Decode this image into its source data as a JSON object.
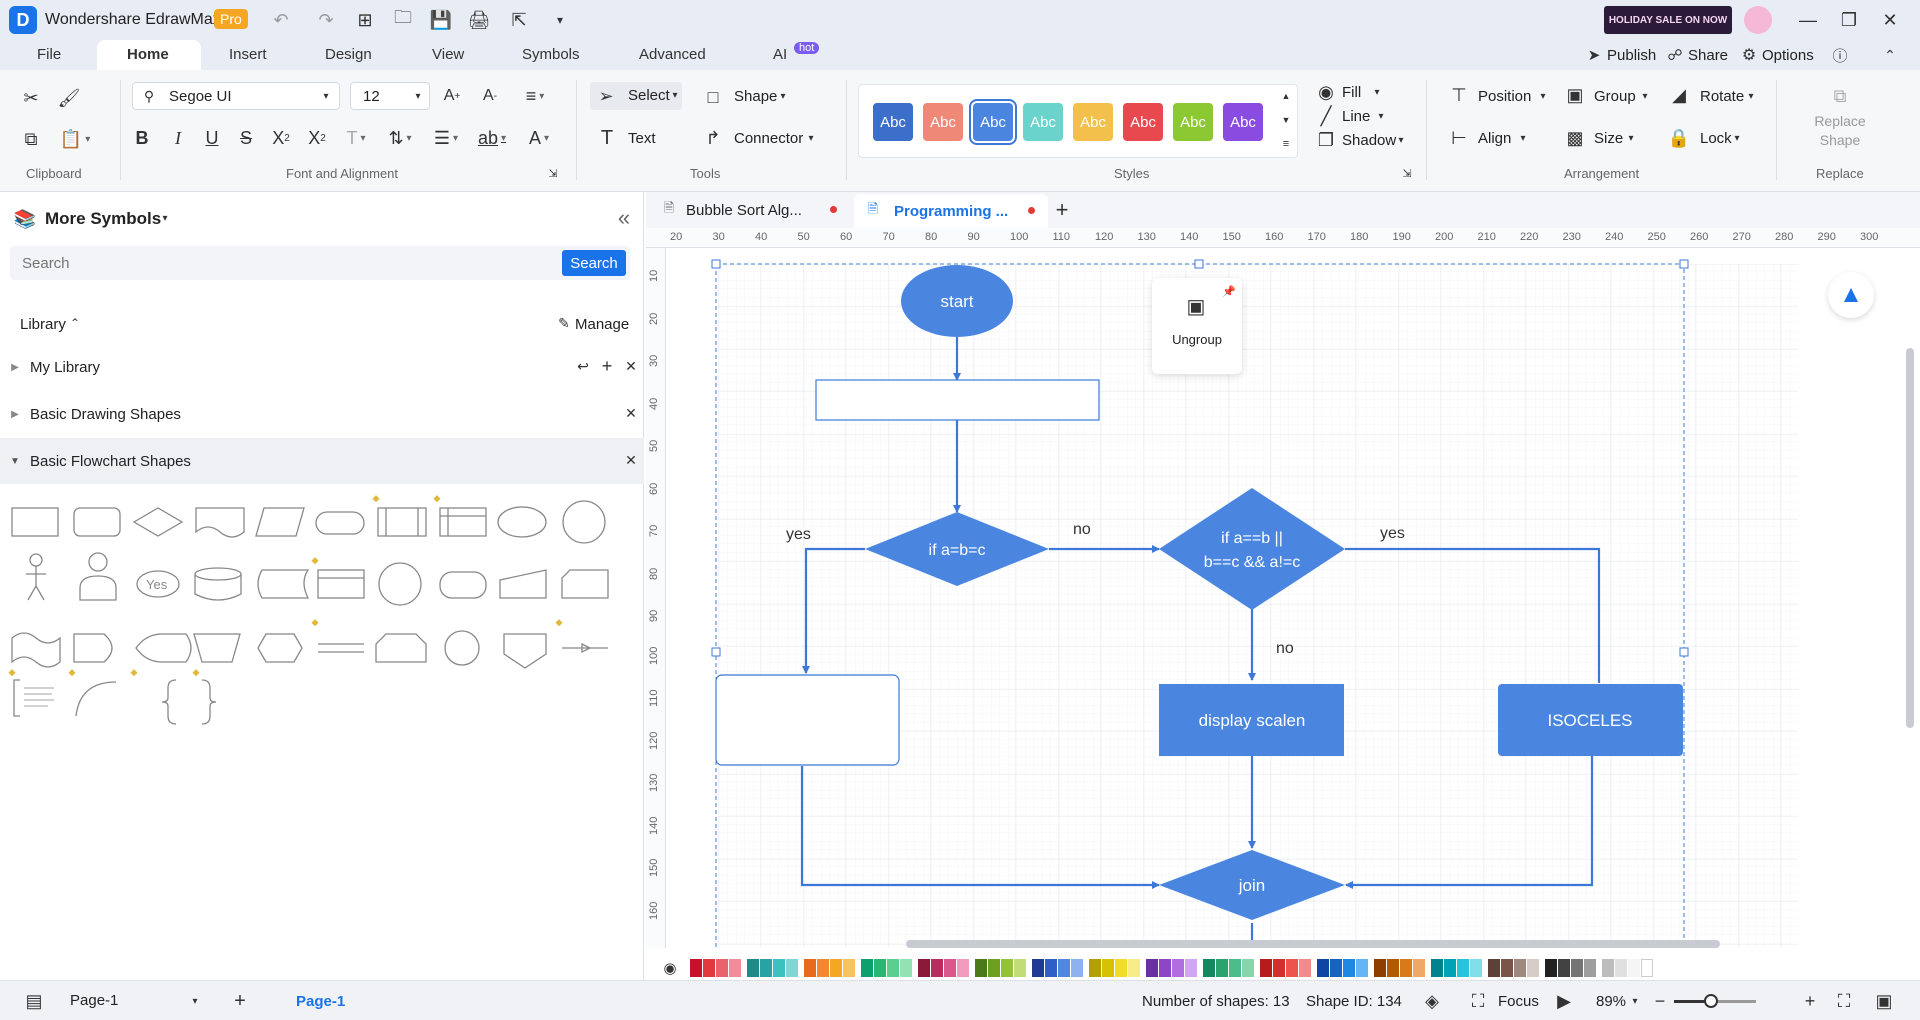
{
  "app": {
    "title": "Wondershare EdrawMax",
    "badge": "Pro",
    "promo": "HOLIDAY SALE ON NOW"
  },
  "menu": {
    "tabs": [
      "File",
      "Home",
      "Insert",
      "Design",
      "View",
      "Symbols",
      "Advanced",
      "AI"
    ],
    "active": "Home",
    "ai_badge": "hot",
    "publish": "Publish",
    "share": "Share",
    "options": "Options"
  },
  "ribbon": {
    "font": "Segoe UI",
    "size": "12",
    "select": "Select",
    "shape": "Shape",
    "text": "Text",
    "connector": "Connector",
    "style_swatch_label": "Abc",
    "style_colors": [
      "#3b6fc9",
      "#ef8876",
      "#4a86e0",
      "#6ad3cc",
      "#f4c04c",
      "#e8494f",
      "#8bc832",
      "#8a4be0"
    ],
    "fill": "Fill",
    "line": "Line",
    "shadow": "Shadow",
    "position": "Position",
    "group": "Group",
    "rotate": "Rotate",
    "align": "Align",
    "size_label": "Size",
    "lock": "Lock",
    "replace_shape": "Replace Shape",
    "groups": {
      "clipboard": "Clipboard",
      "font": "Font and Alignment",
      "tools": "Tools",
      "styles": "Styles",
      "arrangement": "Arrangement",
      "replace": "Replace"
    }
  },
  "sidebar": {
    "title": "More Symbols",
    "search_placeholder": "Search",
    "search_button": "Search",
    "library": "Library",
    "manage": "Manage",
    "sections": [
      "My Library",
      "Basic Drawing Shapes",
      "Basic Flowchart Shapes"
    ],
    "yes_shape": "Yes"
  },
  "doc_tabs": [
    "Bubble Sort Alg...",
    "Programming ..."
  ],
  "ruler_h": [
    "20",
    "30",
    "40",
    "50",
    "60",
    "70",
    "80",
    "90",
    "100",
    "110",
    "120",
    "130",
    "140",
    "150",
    "160",
    "170",
    "180",
    "190",
    "200",
    "210",
    "220",
    "230",
    "240",
    "250",
    "260",
    "270",
    "280",
    "290",
    "300"
  ],
  "ruler_v": [
    "10",
    "20",
    "30",
    "40",
    "50",
    "60",
    "70",
    "80",
    "90",
    "100",
    "110",
    "120",
    "130",
    "140",
    "150",
    "160"
  ],
  "flow": {
    "start": "start",
    "decision1": "if a=b=c",
    "decision2_line1": "if a==b ||",
    "decision2_line2": "b==c && a!=c",
    "yes_left": "yes",
    "no_top": "no",
    "yes_right": "yes",
    "no_down": "no",
    "display": "display scalen",
    "isoceles": "ISOCELES",
    "join": "join",
    "ungroup": "Ungroup"
  },
  "colors": {
    "accent": "#4a86e0",
    "shape_stroke": "#3b78d8",
    "tab_active": "#1a73e8"
  },
  "palette": [
    "#c8102e",
    "#e03a3e",
    "#e8636b",
    "#f28b9b",
    "#1f8a8a",
    "#28a3a3",
    "#3cc1c1",
    "#7ed6d6",
    "#e86a1c",
    "#f08a2c",
    "#f5a623",
    "#f7c35f",
    "#0e9f6e",
    "#2bb673",
    "#5ccf8f",
    "#95e1b3",
    "#8b1a3a",
    "#b62d5e",
    "#d9578a",
    "#f19bbf",
    "#4d7a18",
    "#6ea01f",
    "#93c23a",
    "#c0dd7a",
    "#1f3a93",
    "#2f5fc4",
    "#4f86e0",
    "#8cb3ef",
    "#b3a100",
    "#d6c100",
    "#f0dc2a",
    "#f7ec8a",
    "#6b2fa0",
    "#8e46c8",
    "#b06ee0",
    "#d2a6f0",
    "#138a5e",
    "#2ba36f",
    "#4cbd8a",
    "#86d6ac",
    "#b71c1c",
    "#d32f2f",
    "#ef5350",
    "#f48a8a",
    "#0d47a1",
    "#1565c0",
    "#1e88e5",
    "#64b5f6",
    "#8d3e00",
    "#b35a00",
    "#d97a1a",
    "#efa865",
    "#00838f",
    "#00a3b3",
    "#26c6da",
    "#80deea",
    "#5d4037",
    "#795548",
    "#a1887f",
    "#d7ccc8",
    "#212121",
    "#424242",
    "#757575",
    "#9e9e9e",
    "#bdbdbd",
    "#e0e0e0",
    "#f5f5f5",
    "#ffffff"
  ],
  "status": {
    "page_select": "Page-1",
    "page_tab": "Page-1",
    "shapes": "Number of shapes: 13",
    "shape_id": "Shape ID: 134",
    "focus": "Focus",
    "zoom": "89%",
    "zoom_fraction": 0.45
  }
}
